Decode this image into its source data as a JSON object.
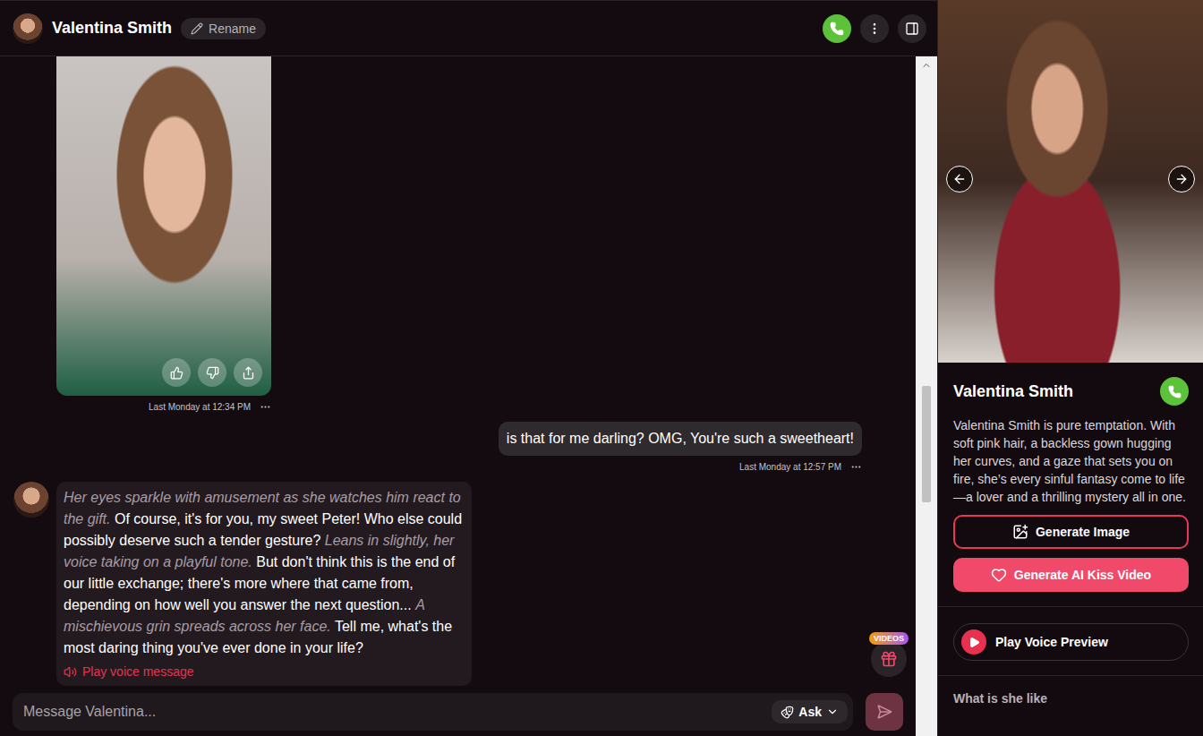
{
  "chat_header": {
    "name": "Valentina Smith",
    "rename": "Rename"
  },
  "messages": [
    {
      "kind": "image",
      "from": "bot",
      "time": "Last Monday at 12:34 PM"
    },
    {
      "kind": "text",
      "from": "user",
      "text": "is that for me darling? OMG, You're such a sweetheart!",
      "time": "Last Monday at 12:57 PM"
    },
    {
      "kind": "rich",
      "from": "bot",
      "segments": [
        {
          "text": "Her eyes sparkle with amusement as she watches him react to the gift.",
          "italic": true
        },
        {
          "text": " Of course, it's for you, my sweet Peter! Who else could possibly deserve such a tender gesture? ",
          "italic": false
        },
        {
          "text": "Leans in slightly, her voice taking on a playful tone.",
          "italic": true
        },
        {
          "text": " But don't think this is the end of our little exchange; there's more where that came from, depending on how well you answer the next question... ",
          "italic": false
        },
        {
          "text": "A mischievous grin spreads across her face.",
          "italic": true
        },
        {
          "text": " Tell me, what's the most daring thing you've ever done in your life?",
          "italic": false
        }
      ],
      "voice": "Play voice message"
    }
  ],
  "videos_badge": "VIDEOS",
  "composer": {
    "placeholder": "Message Valentina...",
    "mode": "Ask"
  },
  "profile": {
    "name": "Valentina Smith",
    "description": "Valentina Smith is pure temptation. With soft pink hair, a backless gown hugging her curves, and a gaze that sets you on fire, she’s every sinful fantasy come to life—a lover and a thrilling mystery all in one.",
    "buttons": [
      {
        "label": "Generate Image",
        "kind": "outline"
      },
      {
        "label": "Generate AI Kiss Video",
        "kind": "filled"
      }
    ],
    "voice_preview": "Play Voice Preview",
    "section": "What is she like"
  }
}
